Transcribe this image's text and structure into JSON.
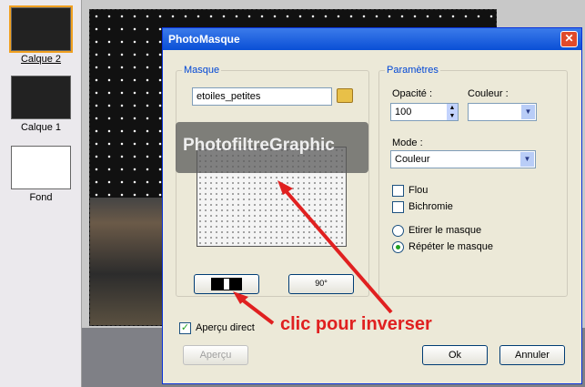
{
  "layers": [
    {
      "name": "Calque 2",
      "selected": true
    },
    {
      "name": "Calque 1",
      "selected": false
    },
    {
      "name": "Fond",
      "selected": false
    }
  ],
  "dialog": {
    "title": "PhotoMasque",
    "close_glyph": "✕",
    "mask": {
      "legend": "Masque",
      "file_value": "etoiles_petites",
      "invert_button_icon": "invert-icon",
      "rotate_button_label": "90°",
      "watermark": "PhotofiltreGraphic"
    },
    "params": {
      "legend": "Paramètres",
      "opacity_label": "Opacité :",
      "opacity_value": "100",
      "color_label": "Couleur :",
      "mode_label": "Mode :",
      "mode_value": "Couleur",
      "flou_label": "Flou",
      "bichromie_label": "Bichromie",
      "stretch_label": "Etirer le masque",
      "repeat_label": "Répéter le masque",
      "selected_option": "repeat"
    },
    "preview_label": "Aperçu direct",
    "preview_checked": true,
    "apercu_button": "Aperçu",
    "ok_button": "Ok",
    "cancel_button": "Annuler"
  },
  "annotation": "clic pour inverser",
  "colors": {
    "accent": "#0046d5",
    "annotation": "#e02020",
    "titlebar": "#0a4fd6"
  }
}
